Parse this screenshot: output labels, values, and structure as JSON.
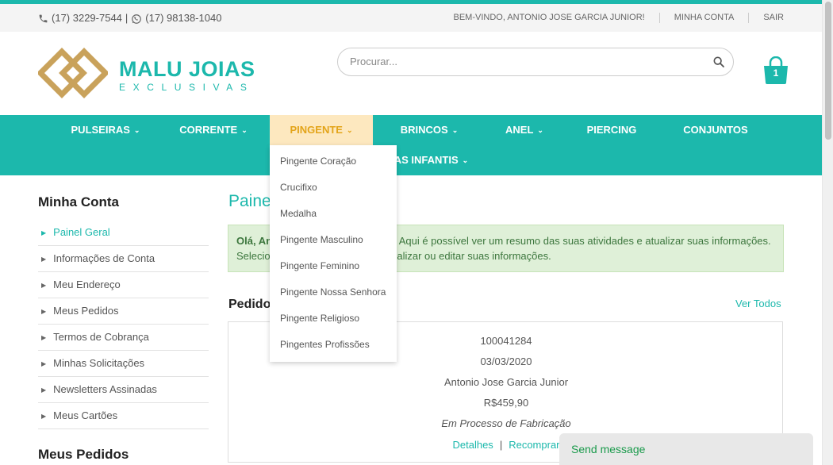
{
  "topbar": {
    "phone_icon": "phone-icon",
    "phone": "(17) 3229-7544",
    "separator": "|",
    "whatsapp_icon": "whatsapp-icon",
    "whatsapp": "(17) 98138-1040",
    "welcome": "BEM-VINDO, ANTONIO JOSE GARCIA JUNIOR!",
    "my_account": "MINHA CONTA",
    "logout": "SAIR"
  },
  "header": {
    "logo_title": "MALU JOIAS",
    "logo_subtitle": "EXCLUSIVAS",
    "search_placeholder": "Procurar...",
    "search_icon": "search-icon",
    "cart_icon": "shopping-bag-icon",
    "cart_count": "1"
  },
  "nav": {
    "items": [
      {
        "label": "PULSEIRAS",
        "chevron": "⌄"
      },
      {
        "label": "CORRENTE",
        "chevron": "⌄"
      },
      {
        "label": "PINGENTE",
        "chevron": "⌄",
        "active": true
      },
      {
        "label": "BRINCOS",
        "chevron": "⌄"
      },
      {
        "label": "ANEL",
        "chevron": "⌄"
      },
      {
        "label": "PIERCING"
      },
      {
        "label": "CONJUNTOS"
      },
      {
        "label": "JOIAS INFANTIS",
        "chevron": "⌄"
      }
    ],
    "dropdown": [
      "Pingente Coração",
      "Crucifixo",
      "Medalha",
      "Pingente Masculino",
      "Pingente Feminino",
      "Pingente Nossa Senhora",
      "Pingente Religioso",
      "Pingentes Profissões"
    ]
  },
  "sidebar": {
    "title": "Minha Conta",
    "items": [
      {
        "label": "Painel Geral",
        "active": true
      },
      {
        "label": "Informações de Conta"
      },
      {
        "label": "Meu Endereço"
      },
      {
        "label": "Meus Pedidos"
      },
      {
        "label": "Termos de Cobrança"
      },
      {
        "label": "Minhas Solicitações"
      },
      {
        "label": "Newsletters Assinadas"
      },
      {
        "label": "Meus Cartões"
      }
    ],
    "second_title": "Meus Pedidos"
  },
  "main": {
    "title": "Painel Geral",
    "alert_greeting": "Olá, Antonio Jose Garcia Junior!",
    "alert_text": "Aqui é possível ver um resumo das suas atividades e atualizar suas informações. Selecione os links abaixo para visualizar ou editar suas informações.",
    "orders_title": "Pedidos Recentes",
    "view_all": "Ver Todos",
    "order": {
      "number": "100041284",
      "date": "03/03/2020",
      "customer": "Antonio Jose Garcia Junior",
      "total": "R$459,90",
      "status": "Em Processo de Fabricação",
      "details_link": "Detalhes",
      "separator": "|",
      "reorder_link": "Recomprar"
    }
  },
  "chat": {
    "label": "Send message"
  },
  "colors": {
    "accent": "#1cb8ac",
    "gold": "#c9a25b",
    "active_nav_bg": "#fde8bf",
    "active_nav_text": "#e3a419"
  }
}
